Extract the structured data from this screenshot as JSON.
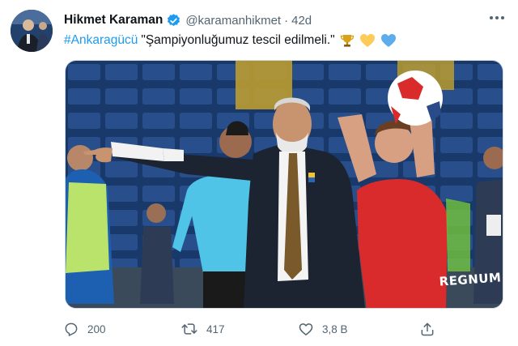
{
  "tweet": {
    "author_name": "Hikmet Karaman",
    "handle": "@karamanhikmet",
    "separator": "·",
    "time": "42d",
    "hashtag": "#Ankaragücü",
    "quote": "\"Şampiyonluğumuz tescil edilmeli.\"",
    "emojis": [
      "trophy-icon",
      "yellow-heart-icon",
      "blue-heart-icon"
    ],
    "media": {
      "jersey_text": "REGNUM"
    }
  },
  "actions": {
    "reply_count": "200",
    "retweet_count": "417",
    "like_count": "3,8 B"
  },
  "colors": {
    "link": "#1d9bf0",
    "secondary_text": "#536471",
    "verified": "#1d9bf0",
    "jersey_red": "#d92b2b",
    "referee_cyan": "#4fc4e6"
  }
}
